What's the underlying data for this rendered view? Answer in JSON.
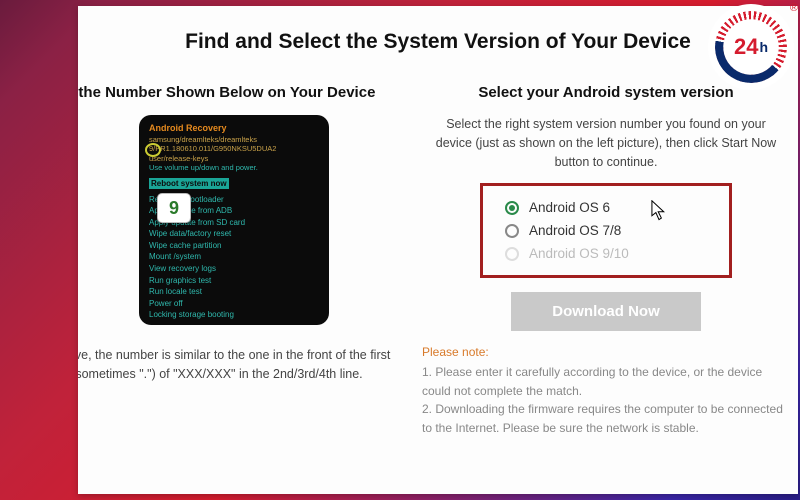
{
  "logo": {
    "text": "24",
    "suffix": "h",
    "trademark": "®"
  },
  "main_title": "Find and Select the System Version of Your Device",
  "left": {
    "sub_title": "Find the Number Shown Below on Your Device",
    "badge_number": "9",
    "recovery": {
      "title": "Android Recovery",
      "line1": "samsung/dreamlteks/dreamlteks",
      "line2": "9/PR1.180610.011/G950NKSU5DUA2",
      "line3": "user/release-keys",
      "line4": "Use volume up/down and power.",
      "highlight": "Reboot system now",
      "items": [
        "Reboot to bootloader",
        "Apply update from ADB",
        "Apply update from SD card",
        "Wipe data/factory reset",
        "Wipe cache partition",
        "Mount /system",
        "View recovery logs",
        "Run graphics test",
        "Run locale test",
        "Power off",
        "Locking storage booting"
      ]
    },
    "caption": "own above, the number is similar to the one in the front of the first \"/\" (sometimes \".\") of \"XXX/XXX\" in the 2nd/3rd/4th line."
  },
  "right": {
    "sub_title": "Select your Android system version",
    "instruction": "Select the right system version number you found on your device (just as shown on the left picture), then click Start Now button to continue.",
    "options": [
      {
        "label": "Android OS 6",
        "selected": true,
        "faded": false
      },
      {
        "label": "Android OS 7/8",
        "selected": false,
        "faded": false
      },
      {
        "label": "Android OS 9/10",
        "selected": false,
        "faded": true
      }
    ],
    "download_label": "Download Now",
    "note_head": "Please note:",
    "note1": "1. Please enter it carefully according to the device, or the device could not complete the match.",
    "note2": "2. Downloading the firmware requires the computer to be connected to the Internet. Please be sure the network is stable."
  }
}
